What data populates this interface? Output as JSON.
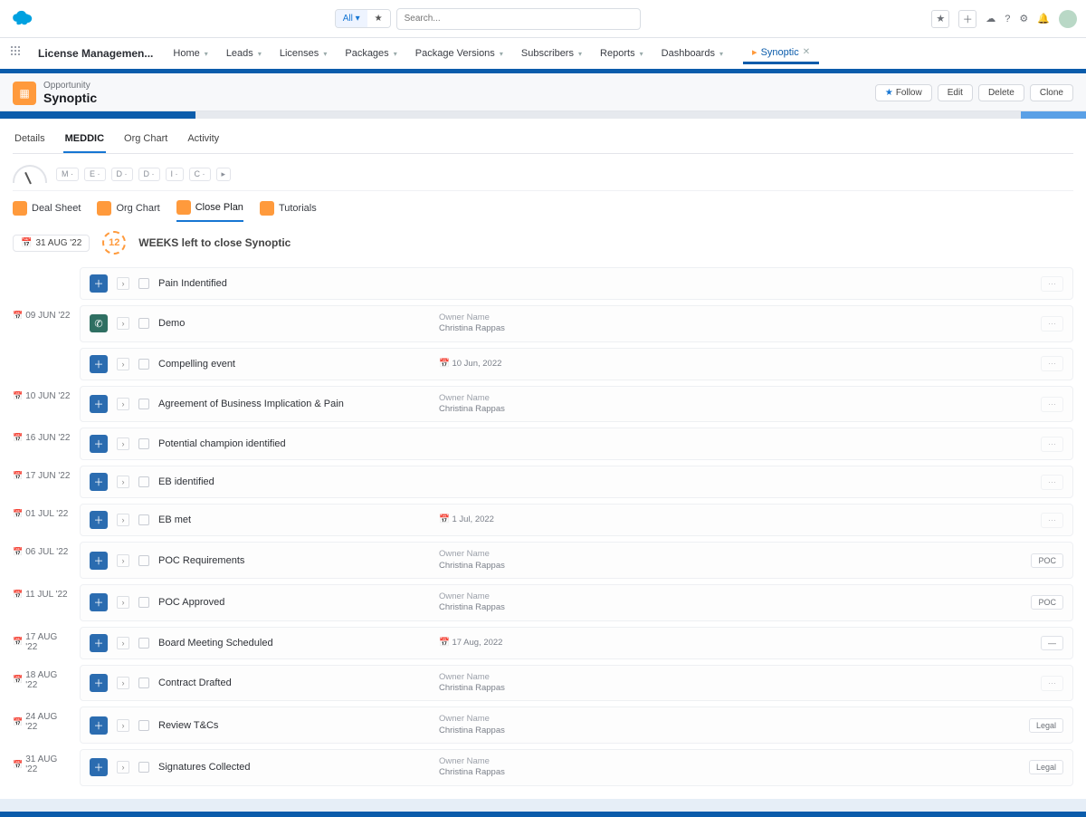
{
  "app": {
    "name": "License Managemen..."
  },
  "nav": {
    "items": [
      "Home",
      "Leads",
      "Licenses",
      "Packages",
      "Package Versions",
      "Subscribers",
      "Reports",
      "Dashboards"
    ],
    "pill": "Synoptic"
  },
  "search": {
    "placeholder": "Search..."
  },
  "record": {
    "type": "Opportunity",
    "name": "Synoptic",
    "actions": {
      "follow": "Follow",
      "edit": "Edit",
      "delete": "Delete",
      "clone": "Clone"
    }
  },
  "tabs": {
    "details": "Details",
    "meddic": "MEDDIC",
    "orgchart": "Org Chart",
    "activity": "Activity"
  },
  "subtabs": {
    "dealsheet": "Deal Sheet",
    "orgchart": "Org Chart",
    "closeplan": "Close Plan",
    "tutorials": "Tutorials"
  },
  "weeks": {
    "chip": "31 AUG '22",
    "count": "12",
    "text": "WEEKS left to close Synoptic"
  },
  "owner": {
    "label": "Owner Name",
    "name": "Christina Rappas"
  },
  "cards": [
    {
      "date": "",
      "icon": "plus",
      "title": "Pain Indentified",
      "meta_type": "none",
      "badge": ""
    },
    {
      "date": "09 JUN '22",
      "icon": "phone",
      "title": "Demo",
      "meta_type": "owner",
      "badge": ""
    },
    {
      "date": "",
      "icon": "plus",
      "title": "Compelling event",
      "meta_type": "date",
      "meta_date": "10 Jun, 2022",
      "badge": ""
    },
    {
      "date": "10 JUN '22",
      "icon": "plus",
      "title": "Agreement of Business Implication & Pain",
      "meta_type": "owner",
      "badge": ""
    },
    {
      "date": "16 JUN '22",
      "icon": "plus",
      "title": "Potential champion identified",
      "meta_type": "none",
      "badge": ""
    },
    {
      "date": "17 JUN '22",
      "icon": "plus",
      "title": "EB identified",
      "meta_type": "none",
      "badge": ""
    },
    {
      "date": "01 JUL '22",
      "icon": "plus",
      "title": "EB met",
      "meta_type": "date",
      "meta_date": "1 Jul, 2022",
      "badge": ""
    },
    {
      "date": "06 JUL '22",
      "icon": "plus",
      "title": "POC Requirements",
      "meta_type": "owner",
      "badge": "POC"
    },
    {
      "date": "11 JUL '22",
      "icon": "plus",
      "title": "POC Approved",
      "meta_type": "owner",
      "badge": "POC"
    },
    {
      "date": "17 AUG '22",
      "icon": "plus",
      "title": "Board Meeting Scheduled",
      "meta_type": "date",
      "meta_date": "17 Aug, 2022",
      "badge": "—"
    },
    {
      "date": "18 AUG '22",
      "icon": "plus",
      "title": "Contract Drafted",
      "meta_type": "owner",
      "badge": ""
    },
    {
      "date": "24 AUG '22",
      "icon": "plus",
      "title": "Review T&Cs",
      "meta_type": "owner",
      "badge": "Legal"
    },
    {
      "date": "31 AUG '22",
      "icon": "plus",
      "title": "Signatures Collected",
      "meta_type": "owner",
      "badge": "Legal"
    }
  ]
}
